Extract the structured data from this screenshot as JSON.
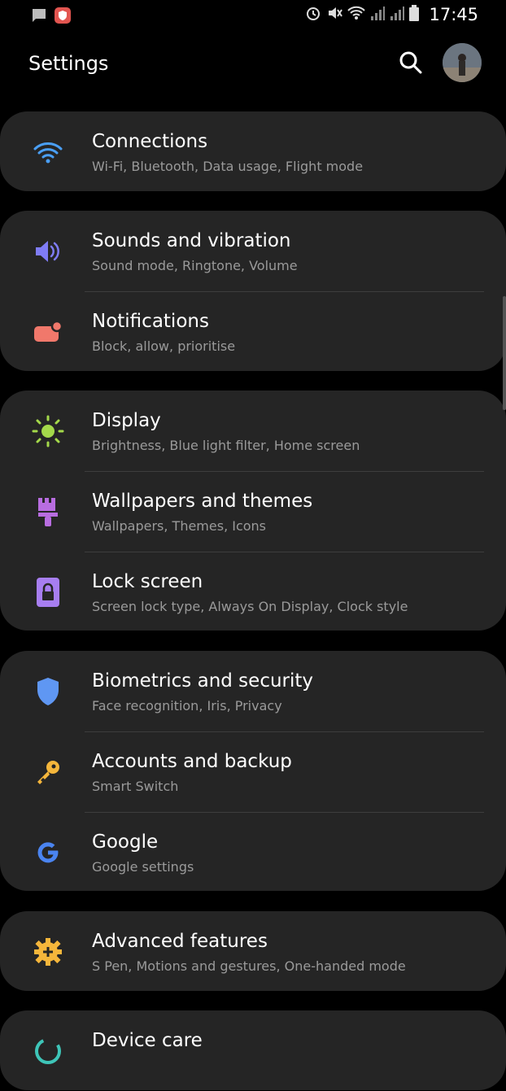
{
  "status_bar": {
    "time": "17:45",
    "left_icons": [
      "message-icon",
      "shield-notification-icon"
    ],
    "right_icons": [
      "alarm-icon",
      "mute-icon",
      "wifi-icon",
      "signal-icon",
      "signal-icon",
      "battery-icon"
    ]
  },
  "header": {
    "title": "Settings",
    "search_icon": "search-icon",
    "avatar_icon": "profile-avatar"
  },
  "accent_colors": {
    "connections": "#4a9ff5",
    "sounds": "#7f7cf5",
    "notifications": "#f0786b",
    "display": "#a4d94a",
    "wallpapers": "#b86de0",
    "lock": "#a77ef0",
    "biometrics": "#5f97f3",
    "accounts": "#f5b63b",
    "google": "#4a84f0",
    "advanced": "#f5b63b",
    "device_care": "#3ec5b8"
  },
  "groups": [
    {
      "items": [
        {
          "icon": "wifi-icon",
          "label": "Connections",
          "sub": "Wi-Fi, Bluetooth, Data usage, Flight mode"
        }
      ]
    },
    {
      "items": [
        {
          "icon": "speaker-icon",
          "label": "Sounds and vibration",
          "sub": "Sound mode, Ringtone, Volume"
        },
        {
          "icon": "notification-icon",
          "label": "Notifications",
          "sub": "Block, allow, prioritise"
        }
      ]
    },
    {
      "items": [
        {
          "icon": "brightness-icon",
          "label": "Display",
          "sub": "Brightness, Blue light filter, Home screen"
        },
        {
          "icon": "paintbrush-icon",
          "label": "Wallpapers and themes",
          "sub": "Wallpapers, Themes, Icons"
        },
        {
          "icon": "lock-icon",
          "label": "Lock screen",
          "sub": "Screen lock type, Always On Display, Clock style"
        }
      ]
    },
    {
      "items": [
        {
          "icon": "shield-icon",
          "label": "Biometrics and security",
          "sub": "Face recognition, Iris, Privacy"
        },
        {
          "icon": "key-icon",
          "label": "Accounts and backup",
          "sub": "Smart Switch"
        },
        {
          "icon": "google-icon",
          "label": "Google",
          "sub": "Google settings"
        }
      ]
    },
    {
      "items": [
        {
          "icon": "gear-plus-icon",
          "label": "Advanced features",
          "sub": "S Pen, Motions and gestures, One-handed mode"
        }
      ]
    },
    {
      "items": [
        {
          "icon": "device-care-icon",
          "label": "Device care",
          "sub": ""
        }
      ]
    }
  ]
}
